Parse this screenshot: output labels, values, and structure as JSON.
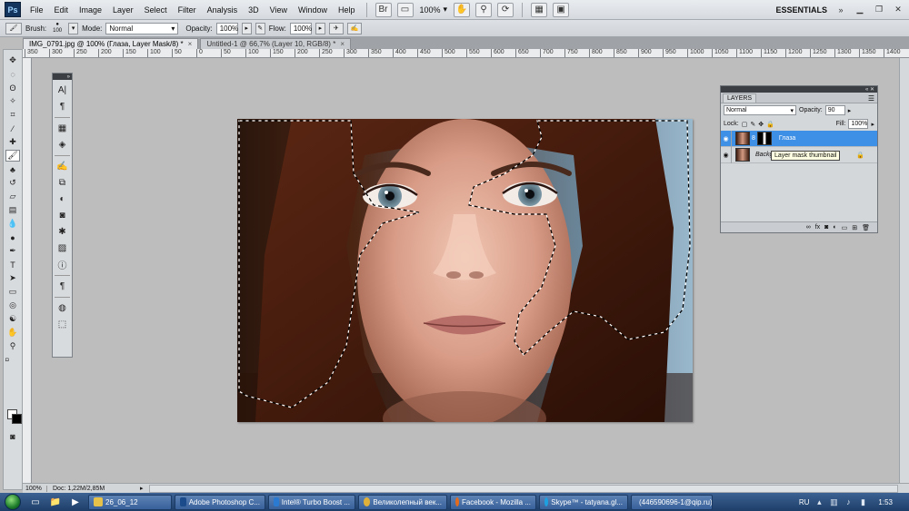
{
  "app": {
    "logo": "Ps",
    "menu": [
      "File",
      "Edit",
      "Image",
      "Layer",
      "Select",
      "Filter",
      "Analysis",
      "3D",
      "View",
      "Window",
      "Help"
    ],
    "zoom": "100%",
    "workspace": "ESSENTIALS",
    "menubar_icons": [
      "bridge-icon",
      "mini-bridge-icon",
      "hand-icon",
      "zoom-icon",
      "rotate-icon",
      "arrange-icon",
      "screen-mode-icon"
    ]
  },
  "options": {
    "brush_label": "Brush:",
    "brush_size": "100",
    "mode_label": "Mode:",
    "mode_value": "Normal",
    "opacity_label": "Opacity:",
    "opacity_value": "100%",
    "flow_label": "Flow:",
    "flow_value": "100%"
  },
  "tabs": [
    {
      "label": "IMG_0791.jpg @ 100% (Глаза, Layer Mask/8) *",
      "close": "×"
    },
    {
      "label": "Untitled-1 @ 66,7% (Layer 10, RGB/8) *",
      "close": "×"
    }
  ],
  "ruler_top": [
    "350",
    "300",
    "250",
    "200",
    "150",
    "100",
    "50",
    "0",
    "50",
    "100",
    "150",
    "200",
    "250",
    "300",
    "350",
    "400",
    "450",
    "500",
    "550",
    "600",
    "650",
    "700",
    "750",
    "800",
    "850",
    "900",
    "950",
    "1000",
    "1050",
    "1100",
    "1150",
    "1200",
    "1250",
    "1300",
    "1350",
    "1400"
  ],
  "layers": {
    "tab": "LAYERS",
    "blend_mode": "Normal",
    "opacity_label": "Opacity:",
    "opacity_value": "90",
    "lock_label": "Lock:",
    "fill_label": "Fill:",
    "fill_value": "100%",
    "items": [
      {
        "name": "Глаза",
        "selected": true
      },
      {
        "name": "Background",
        "selected": false
      }
    ],
    "tooltip": "Layer mask thumbnail",
    "footer_icons": [
      "link-icon",
      "fx",
      "mask-icon",
      "adjust-icon",
      "folder-icon",
      "new-layer-icon",
      "trash-icon"
    ]
  },
  "status": {
    "zoom": "100%",
    "doc": "Doc: 1,22M/2,85M"
  },
  "taskbar": {
    "tasks": [
      {
        "label": "26_06_12",
        "color": "#e7c24a"
      },
      {
        "label": "Adobe Photoshop C...",
        "color": "#1b4b8a"
      },
      {
        "label": "Intel® Turbo Boost ...",
        "color": "#2b7ad1"
      },
      {
        "label": "Великолепный век...",
        "color": "#e0b13a"
      },
      {
        "label": "Facebook - Mozilla ...",
        "color": "#e36b1d"
      },
      {
        "label": "Skype™ - tatyana.gl...",
        "color": "#1ea1e0"
      },
      {
        "label": "(446590696-1@qip.ru)",
        "color": "#5bb54b"
      }
    ],
    "lang": "RU",
    "time": "1:53"
  }
}
